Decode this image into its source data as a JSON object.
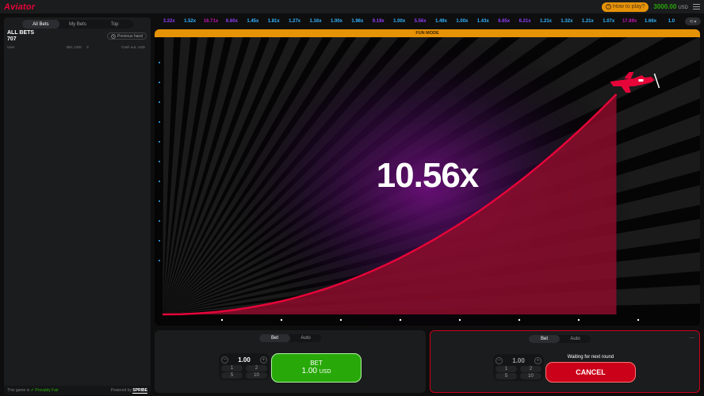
{
  "header": {
    "logo": "Aviator",
    "how_to_play": "How to play?",
    "how_to_play_icon": "question-icon",
    "balance": "3000.00",
    "currency": "USD",
    "menu_icon": "hamburger-menu-icon"
  },
  "sidebar": {
    "tabs": [
      {
        "label": "All Bets",
        "active": true
      },
      {
        "label": "My Bets",
        "active": false
      },
      {
        "label": "Top",
        "active": false
      }
    ],
    "all_bets_title": "ALL BETS",
    "all_bets_count": "707",
    "previous_hand": "Previous hand",
    "previous_hand_icon": "history-icon",
    "columns": {
      "user": "User",
      "bet": "Bet, USD",
      "x": "X",
      "cashout": "Cash out, USD"
    },
    "footer": {
      "game_is": "This game is",
      "provably_fair": "Provably Fair",
      "powered_by": "Powered by",
      "provider": "SPRIBE"
    }
  },
  "history": [
    {
      "value": "3.22x",
      "color": "#913ef8"
    },
    {
      "value": "1.52x",
      "color": "#34b4ff"
    },
    {
      "value": "16.71x",
      "color": "#c017b4"
    },
    {
      "value": "6.60x",
      "color": "#913ef8"
    },
    {
      "value": "1.45x",
      "color": "#34b4ff"
    },
    {
      "value": "1.81x",
      "color": "#34b4ff"
    },
    {
      "value": "1.27x",
      "color": "#34b4ff"
    },
    {
      "value": "1.16x",
      "color": "#34b4ff"
    },
    {
      "value": "1.00x",
      "color": "#34b4ff"
    },
    {
      "value": "1.96x",
      "color": "#34b4ff"
    },
    {
      "value": "9.19x",
      "color": "#913ef8"
    },
    {
      "value": "1.00x",
      "color": "#34b4ff"
    },
    {
      "value": "5.56x",
      "color": "#913ef8"
    },
    {
      "value": "1.49x",
      "color": "#34b4ff"
    },
    {
      "value": "1.00x",
      "color": "#34b4ff"
    },
    {
      "value": "1.43x",
      "color": "#34b4ff"
    },
    {
      "value": "6.65x",
      "color": "#913ef8"
    },
    {
      "value": "6.21x",
      "color": "#913ef8"
    },
    {
      "value": "1.21x",
      "color": "#34b4ff"
    },
    {
      "value": "1.32x",
      "color": "#34b4ff"
    },
    {
      "value": "1.21x",
      "color": "#34b4ff"
    },
    {
      "value": "1.07x",
      "color": "#34b4ff"
    },
    {
      "value": "17.89x",
      "color": "#c017b4"
    },
    {
      "value": "1.66x",
      "color": "#34b4ff"
    },
    {
      "value": "1.0",
      "color": "#34b4ff"
    }
  ],
  "game": {
    "mode_label": "FUN MODE",
    "multiplier": "10.56x",
    "curve_color": "#e50539",
    "plane_icon": "airplane-icon",
    "progress": 0.87
  },
  "bet_panel_1": {
    "tabs": [
      {
        "label": "Bet",
        "active": true
      },
      {
        "label": "Auto",
        "active": false
      }
    ],
    "amount": "1.00",
    "minus_icon": "minus-icon",
    "plus_icon": "plus-icon",
    "quick": [
      "1",
      "2",
      "5",
      "10"
    ],
    "bet_label": "BET",
    "bet_amount": "1.00",
    "bet_currency": "USD"
  },
  "bet_panel_2": {
    "tabs": [
      {
        "label": "Bet",
        "active": true
      },
      {
        "label": "Auto",
        "active": false
      }
    ],
    "amount": "1.00",
    "minus_icon": "minus-icon",
    "plus_icon": "plus-icon",
    "quick": [
      "1",
      "2",
      "5",
      "10"
    ],
    "waiting": "Waiting for next round",
    "cancel_label": "CANCEL",
    "more_icon": "more-icon"
  }
}
